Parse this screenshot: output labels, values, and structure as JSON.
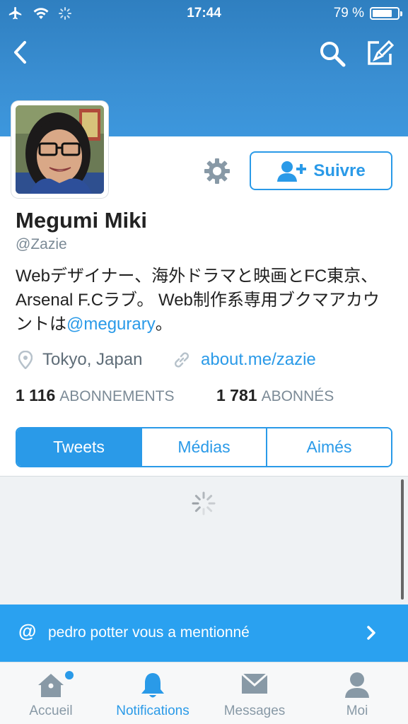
{
  "status_bar": {
    "time": "17:44",
    "battery_text": "79 %",
    "battery_level": 0.79,
    "icons": [
      "airplane-icon",
      "wifi-icon",
      "activity-spinner-icon"
    ]
  },
  "nav": {
    "icons": [
      "back-arrow-icon",
      "search-icon",
      "compose-icon"
    ]
  },
  "profile": {
    "name": "Megumi Miki",
    "handle": "@Zazie",
    "bio_text": "Webデザイナー、海外ドラマと映画とFC東京、Arsenal F.Cラブ。 Web制作系専用ブクマアカウントは",
    "bio_mention": "@megurary",
    "bio_end": "。",
    "location": "Tokyo, Japan",
    "url": "about.me/zazie",
    "following_count": "1 116",
    "following_label": "ABONNEMENTS",
    "followers_count": "1 781",
    "followers_label": "ABONNÉS",
    "follow_label": "Suivre"
  },
  "tabs": [
    {
      "label": "Tweets",
      "active": true
    },
    {
      "label": "Médias",
      "active": false
    },
    {
      "label": "Aimés",
      "active": false
    }
  ],
  "notification": {
    "at": "@",
    "text": "pedro potter vous a mentionné"
  },
  "tab_bar": [
    {
      "label": "Accueil",
      "icon": "home-icon",
      "has_badge": true
    },
    {
      "label": "Notifications",
      "icon": "bell-icon",
      "active": true
    },
    {
      "label": "Messages",
      "icon": "envelope-icon"
    },
    {
      "label": "Moi",
      "icon": "person-icon"
    }
  ],
  "colors": {
    "accent": "#2a9ae8",
    "banner": "#3a8fd3",
    "notification_bg": "#2aa1f0"
  }
}
